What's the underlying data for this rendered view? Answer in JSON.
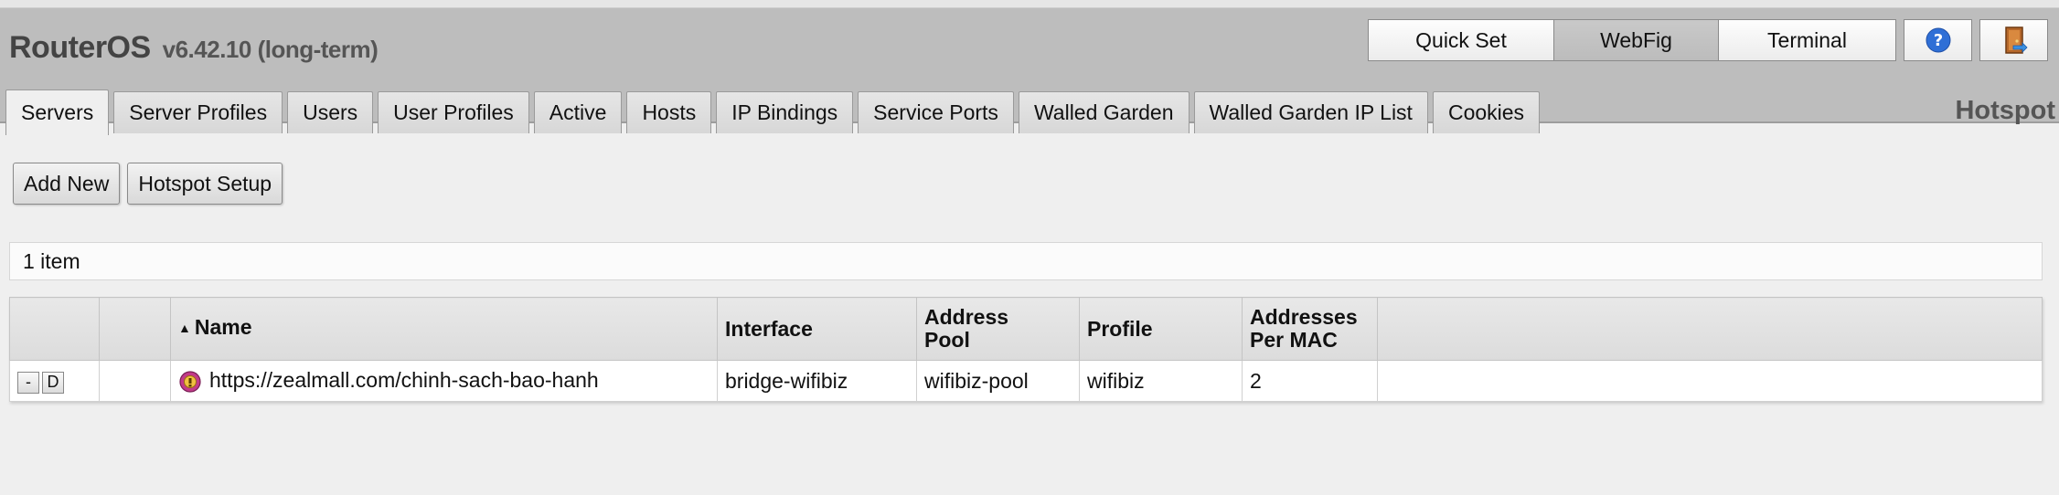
{
  "header": {
    "product": "RouterOS",
    "version": "v6.42.10 (long-term)",
    "modes": [
      "Quick Set",
      "WebFig",
      "Terminal"
    ],
    "active_mode": "WebFig",
    "section": "Hotspot"
  },
  "tabs": [
    {
      "label": "Servers"
    },
    {
      "label": "Server Profiles"
    },
    {
      "label": "Users"
    },
    {
      "label": "User Profiles"
    },
    {
      "label": "Active"
    },
    {
      "label": "Hosts"
    },
    {
      "label": "IP Bindings"
    },
    {
      "label": "Service Ports"
    },
    {
      "label": "Walled Garden"
    },
    {
      "label": "Walled Garden IP List"
    },
    {
      "label": "Cookies"
    }
  ],
  "actions": {
    "add_new": "Add New",
    "hotspot_setup": "Hotspot Setup"
  },
  "item_count": "1 item",
  "table": {
    "columns": {
      "name": "Name",
      "interface": "Interface",
      "address_pool_1": "Address",
      "address_pool_2": "Pool",
      "profile": "Profile",
      "apm_1": "Addresses",
      "apm_2": "Per MAC"
    },
    "rows": [
      {
        "remove_btn": "-",
        "disable_btn": "D",
        "name": "https://zealmall.com/chinh-sach-bao-hanh",
        "interface": "bridge-wifibiz",
        "address_pool": "wifibiz-pool",
        "profile": "wifibiz",
        "addresses_per_mac": "2"
      }
    ]
  },
  "icons": {
    "help": "help-icon",
    "logout": "logout-door-icon",
    "hotspot": "hotspot-server-icon"
  },
  "colors": {
    "header_bg": "#bdbdbd",
    "content_bg": "#efefef",
    "help_blue": "#2f6fd6"
  }
}
